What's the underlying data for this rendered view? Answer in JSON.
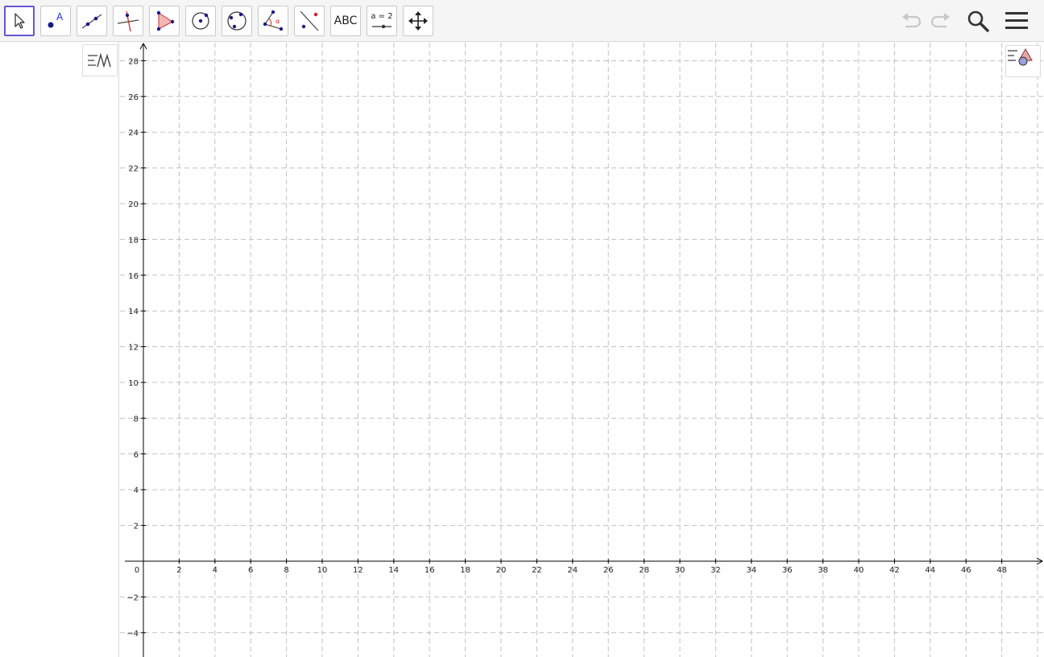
{
  "toolbar": {
    "tools": [
      {
        "name": "move-tool",
        "icon": "arrow-cursor-icon"
      },
      {
        "name": "point-tool",
        "icon": "point-a-icon",
        "label": "A"
      },
      {
        "name": "line-tool",
        "icon": "line-through-points-icon"
      },
      {
        "name": "perpendicular-line-tool",
        "icon": "perpendicular-line-icon"
      },
      {
        "name": "polygon-tool",
        "icon": "polygon-icon"
      },
      {
        "name": "circle-tool",
        "icon": "circle-center-point-icon"
      },
      {
        "name": "circle-three-points-tool",
        "icon": "circle-three-points-icon"
      },
      {
        "name": "angle-tool",
        "icon": "angle-icon",
        "label": "α"
      },
      {
        "name": "reflect-tool",
        "icon": "reflect-about-line-icon"
      },
      {
        "name": "text-tool",
        "icon": "text-icon",
        "label": "ABC"
      },
      {
        "name": "slider-tool",
        "icon": "slider-icon",
        "label": "a = 2"
      },
      {
        "name": "move-graphics-tool",
        "icon": "move-graphics-view-icon"
      }
    ],
    "actions": [
      {
        "name": "undo-button",
        "icon": "undo-icon"
      },
      {
        "name": "redo-button",
        "icon": "redo-icon"
      },
      {
        "name": "search-button",
        "icon": "search-icon"
      },
      {
        "name": "menu-button",
        "icon": "hamburger-menu-icon"
      }
    ]
  },
  "algebra_view": {
    "style_bar_icon": "algebra-style-bar-icon"
  },
  "graphics_view": {
    "style_bar_icon": "graphics-style-bar-icon"
  },
  "chart_data": {
    "type": "grid",
    "x_ticks": [
      "0",
      "2",
      "4",
      "6",
      "8",
      "10",
      "12",
      "14",
      "16",
      "18",
      "20",
      "22",
      "24",
      "26",
      "28",
      "30",
      "32",
      "34",
      "36",
      "38",
      "40",
      "42",
      "44",
      "46",
      "48"
    ],
    "y_ticks": [
      "28",
      "26",
      "24",
      "22",
      "20",
      "18",
      "16",
      "14",
      "12",
      "10",
      "8",
      "6",
      "4",
      "2",
      "−2",
      "−4"
    ],
    "x_step": 2,
    "y_step": 2,
    "grid": true,
    "grid_style": "dashed",
    "colors": {
      "grid": "#c0c0c0",
      "axis": "#000000",
      "accent": "#6557d2",
      "point": "#1a1a8c"
    }
  }
}
